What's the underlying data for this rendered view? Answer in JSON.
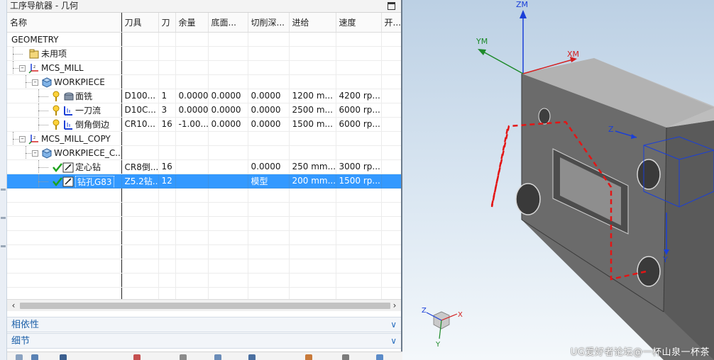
{
  "navigator": {
    "title": "工序导航器 - 几何",
    "columns": [
      "名称",
      "刀具",
      "刀",
      "余量",
      "底面...",
      "切削深...",
      "进给",
      "速度",
      "开..."
    ],
    "rows": [
      {
        "name": "GEOMETRY",
        "tool": "",
        "tn": "",
        "stock": "",
        "floor": "",
        "depth": "",
        "feed": "",
        "speed": "",
        "level": 0,
        "kind": "root",
        "status": "none"
      },
      {
        "name": "未用项",
        "tool": "",
        "tn": "",
        "stock": "",
        "floor": "",
        "depth": "",
        "feed": "",
        "speed": "",
        "level": 1,
        "kind": "unused",
        "status": "none"
      },
      {
        "name": "MCS_MILL",
        "tool": "",
        "tn": "",
        "stock": "",
        "floor": "",
        "depth": "",
        "feed": "",
        "speed": "",
        "level": 1,
        "kind": "mcs",
        "status": "none",
        "expanded": true
      },
      {
        "name": "WORKPIECE",
        "tool": "",
        "tn": "",
        "stock": "",
        "floor": "",
        "depth": "",
        "feed": "",
        "speed": "",
        "level": 2,
        "kind": "workpiece",
        "status": "none",
        "expanded": true
      },
      {
        "name": "面铣",
        "tool": "D100...",
        "tn": "1",
        "stock": "0.0000",
        "floor": "0.0000",
        "depth": "0.0000",
        "feed": "1200 m...",
        "speed": "4200 rp...",
        "level": 3,
        "kind": "face-mill",
        "status": "pending"
      },
      {
        "name": "一刀流",
        "tool": "D10C...",
        "tn": "3",
        "stock": "0.0000",
        "floor": "0.0000",
        "depth": "0.0000",
        "feed": "2500 m...",
        "speed": "6000 rp...",
        "level": 3,
        "kind": "op",
        "status": "pending"
      },
      {
        "name": "倒角倒边",
        "tool": "CR10...",
        "tn": "16",
        "stock": "-1.00...",
        "floor": "0.0000",
        "depth": "0.0000",
        "feed": "1500 m...",
        "speed": "6000 rp...",
        "level": 3,
        "kind": "op",
        "status": "pending"
      },
      {
        "name": "MCS_MILL_COPY",
        "tool": "",
        "tn": "",
        "stock": "",
        "floor": "",
        "depth": "",
        "feed": "",
        "speed": "",
        "level": 1,
        "kind": "mcs",
        "status": "none",
        "expanded": true
      },
      {
        "name": "WORKPIECE_C...",
        "tool": "",
        "tn": "",
        "stock": "",
        "floor": "",
        "depth": "",
        "feed": "",
        "speed": "",
        "level": 2,
        "kind": "workpiece",
        "status": "none",
        "expanded": true
      },
      {
        "name": "定心钻",
        "tool": "CR8倒...",
        "tn": "16",
        "stock": "",
        "floor": "",
        "depth": "0.0000",
        "feed": "250 mm...",
        "speed": "3000 rp...",
        "level": 3,
        "kind": "drill",
        "status": "done"
      },
      {
        "name": "钻孔G83",
        "tool": "Z5.2钻...",
        "tn": "12",
        "stock": "",
        "floor": "",
        "depth": "模型",
        "feed": "200 mm...",
        "speed": "1500 rp...",
        "level": 3,
        "kind": "drill",
        "status": "done",
        "selected": true
      }
    ],
    "empty_rows": 8
  },
  "sections": {
    "dependencies": "相依性",
    "details": "细节"
  },
  "viewport": {
    "axes": {
      "zm": "ZM",
      "ym": "YM",
      "xm": "XM",
      "z": "Z",
      "y": "Y"
    },
    "triad": {
      "x": "X",
      "y": "Y",
      "z": "Z"
    },
    "watermark": "UG爱好者论坛@一杯山泉一杯茶"
  },
  "colors": {
    "selection": "#3399ff",
    "section_text": "#1b5fa8",
    "axis_z": "#1a3fd8",
    "axis_x": "#d42020",
    "axis_y": "#1d8a2a",
    "toolpath": "#e31515",
    "part_gray": "#6b6b6b"
  }
}
